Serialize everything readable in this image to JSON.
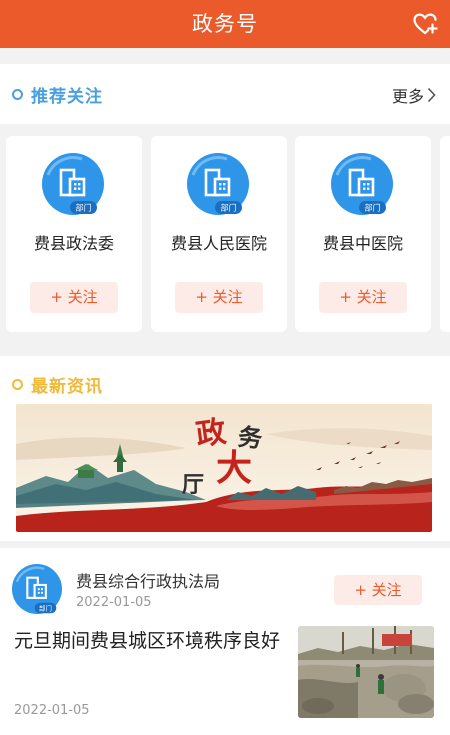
{
  "header": {
    "title": "政务号",
    "favorite_icon": "heart-plus-icon"
  },
  "recommend": {
    "title": "推荐关注",
    "more_label": "更多",
    "cards": [
      {
        "name": "费县政法委",
        "badge": "部门",
        "follow_label": "+ 关注"
      },
      {
        "name": "费县人民医院",
        "badge": "部门",
        "follow_label": "+ 关注"
      },
      {
        "name": "费县中医院",
        "badge": "部门",
        "follow_label": "+ 关注"
      }
    ]
  },
  "latest": {
    "title": "最新资讯",
    "banner_text": [
      "政",
      "务",
      "大",
      "厅"
    ]
  },
  "news": {
    "org": "费县综合行政执法局",
    "badge": "部门",
    "org_date": "2022-01-05",
    "follow_label": "+ 关注",
    "headline": "元旦期间费县城区环境秩序良好",
    "date": "2022-01-05"
  },
  "colors": {
    "brand": "#ea5a2b",
    "blue": "#4aa0de",
    "yellow": "#f1b93a"
  }
}
